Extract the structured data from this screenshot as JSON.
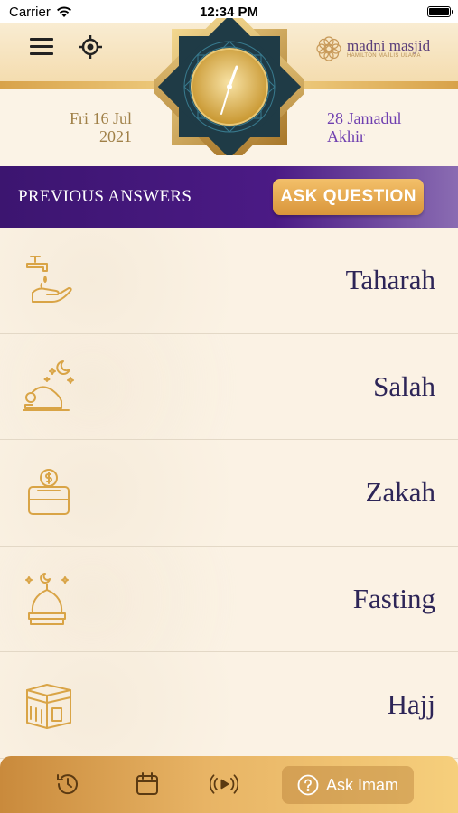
{
  "status_bar": {
    "carrier": "Carrier",
    "time": "12:34 PM"
  },
  "header": {
    "logo_text": "madni masjid",
    "logo_subtext": "HAMILTON MAJLIS ULAMA",
    "gregorian_date_line1": "Fri 16 Jul",
    "gregorian_date_line2": "2021",
    "hijri_date_line1": "28 Jamadul",
    "hijri_date_line2": "Akhir"
  },
  "answers_bar": {
    "previous_answers_label": "PREVIOUS ANSWERS",
    "ask_question_label": "ASK QUESTION"
  },
  "categories": [
    {
      "label": "Taharah",
      "icon": "tap-hand-icon"
    },
    {
      "label": "Salah",
      "icon": "prayer-icon"
    },
    {
      "label": "Zakah",
      "icon": "charity-box-icon"
    },
    {
      "label": "Fasting",
      "icon": "mosque-dome-icon"
    },
    {
      "label": "Hajj",
      "icon": "kaaba-icon"
    }
  ],
  "bottom_nav": {
    "ask_imam_label": "Ask Imam",
    "icons": [
      "history-icon",
      "calendar-icon",
      "broadcast-icon",
      "question-icon"
    ]
  },
  "colors": {
    "primary_purple": "#4b1a85",
    "gold": "#d9953a",
    "background": "#fbf2e4",
    "label_navy": "#2d2557"
  }
}
